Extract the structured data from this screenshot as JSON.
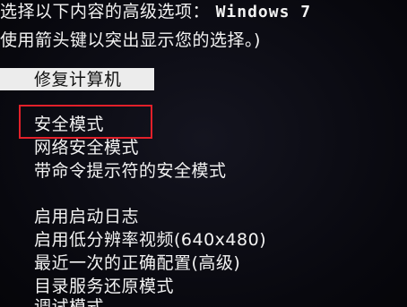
{
  "header": {
    "line1_text": "选择以下内容的高级选项：",
    "line1_os": "Windows 7",
    "line2_text": "使用箭头键以突出显示您的选择。)"
  },
  "repair_item": "修复计算机",
  "menu": {
    "items": [
      {
        "label": "安全模式"
      },
      {
        "label": "网络安全模式"
      },
      {
        "label": "带命令提示符的安全模式"
      },
      {
        "label": "启用启动日志"
      },
      {
        "label": "启用低分辨率视频(640x480)"
      },
      {
        "label": "最近一次的正确配置(高级)"
      },
      {
        "label": "目录服务还原模式"
      },
      {
        "label": "调试模式"
      }
    ]
  },
  "colors": {
    "background": "#0b0b14",
    "text": "#f2f2f2",
    "highlight_bar": "#ececec",
    "selection_border": "#e2202a"
  }
}
